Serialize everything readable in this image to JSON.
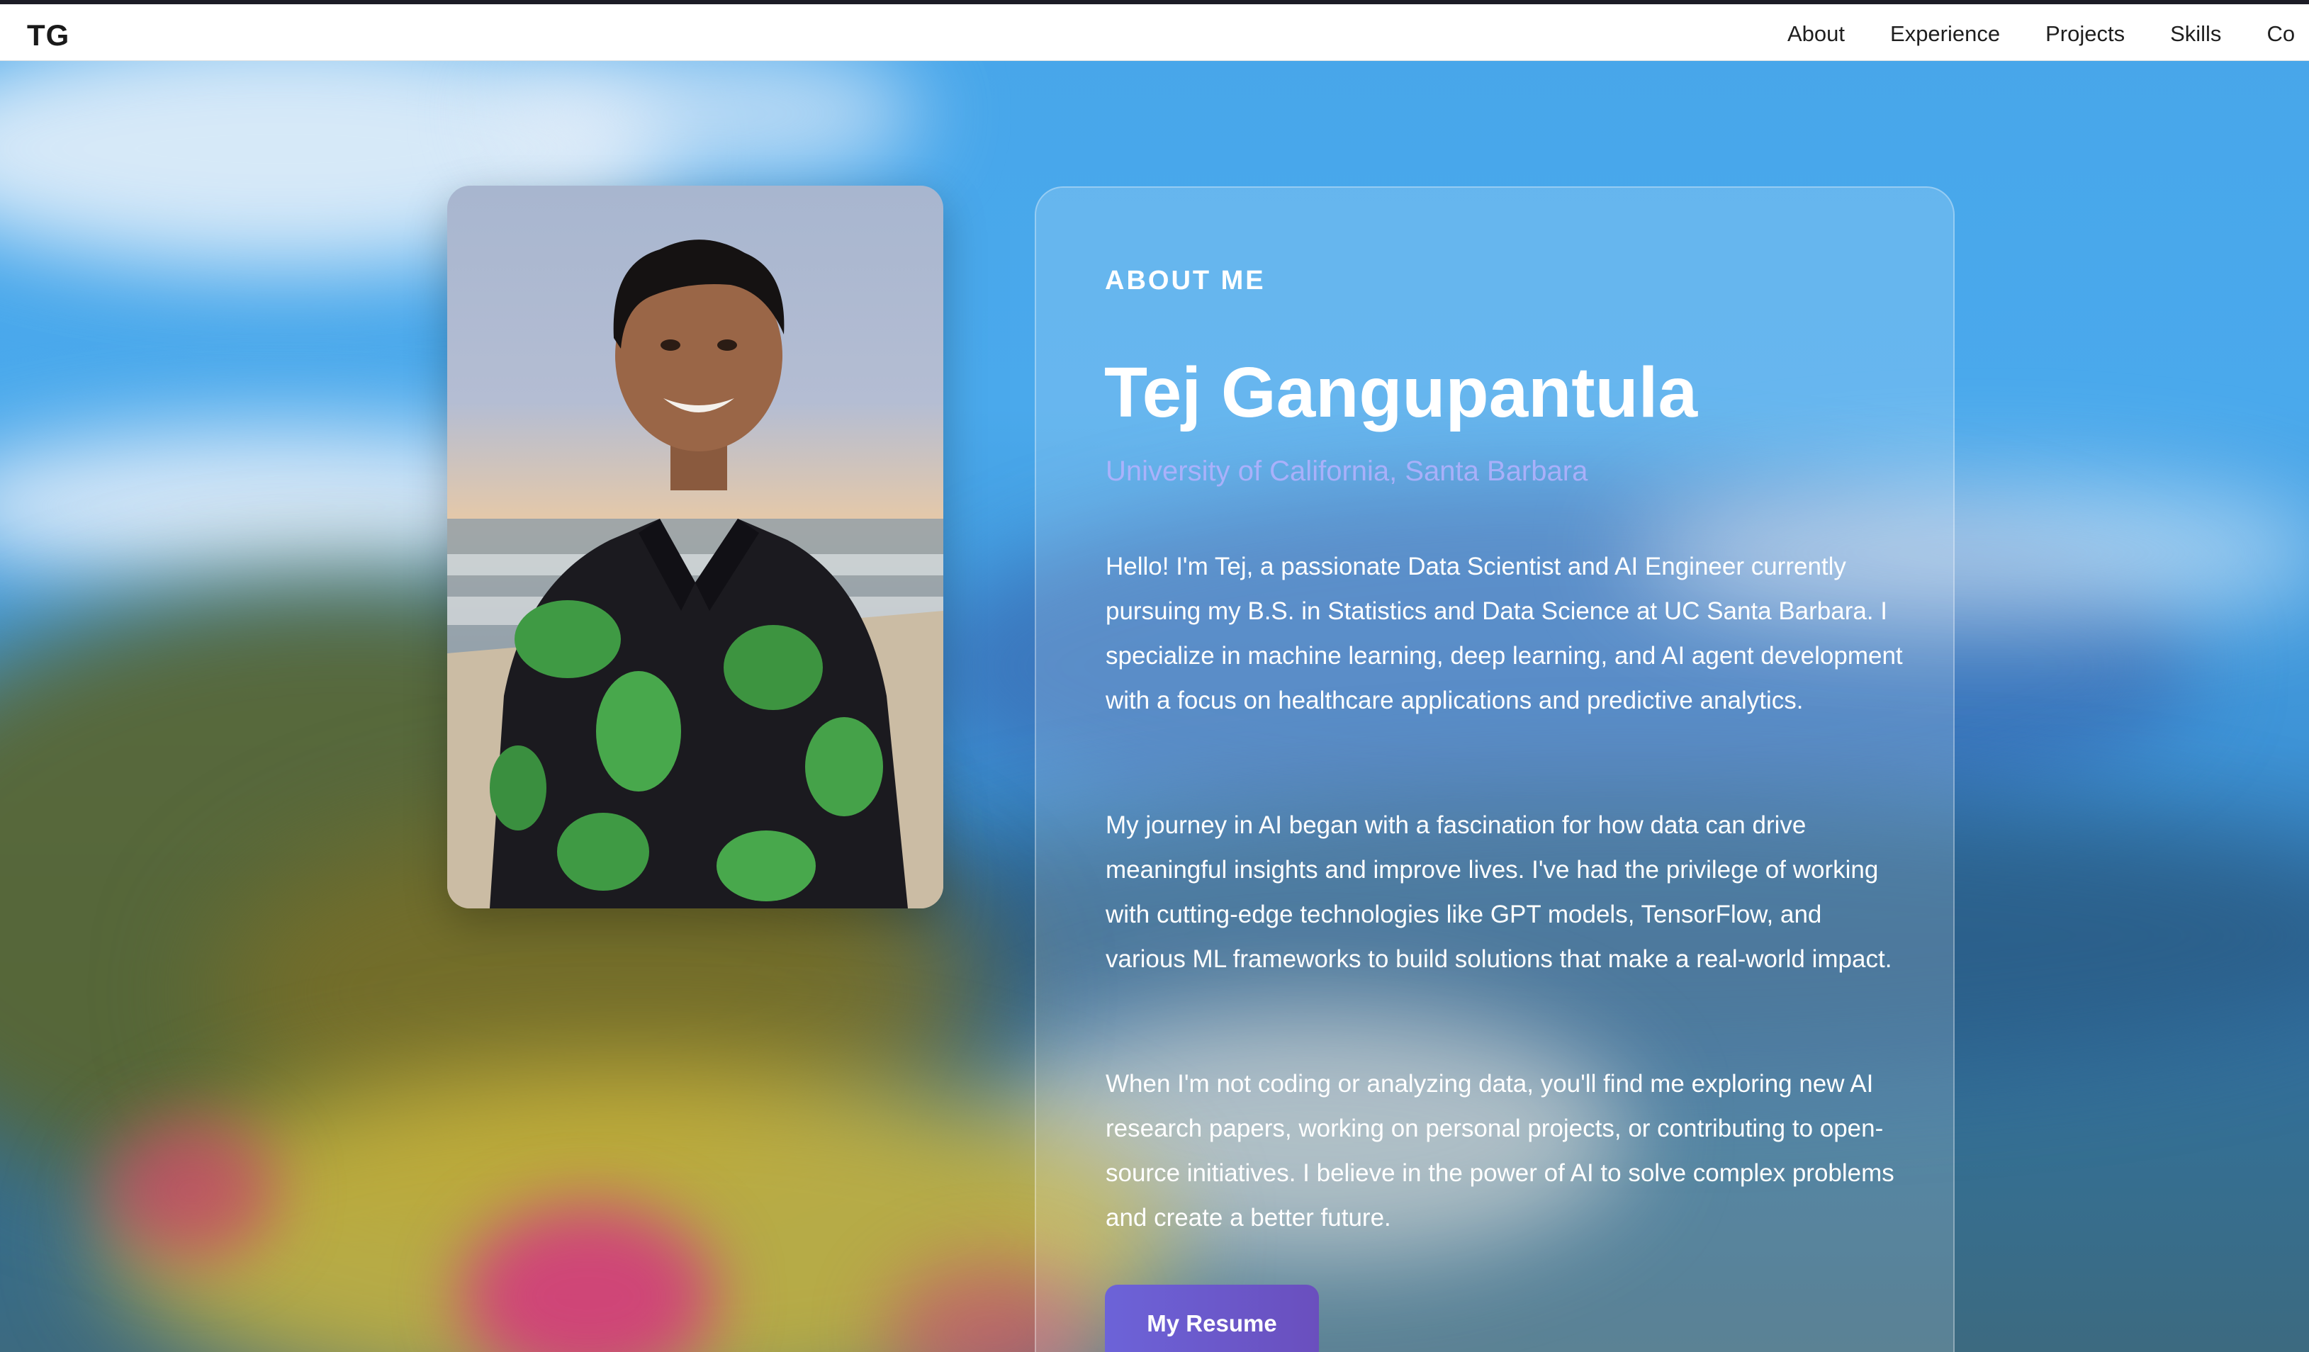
{
  "nav": {
    "logo": "TG",
    "items": [
      {
        "label": "About"
      },
      {
        "label": "Experience"
      },
      {
        "label": "Projects"
      },
      {
        "label": "Skills"
      },
      {
        "label": "Co"
      }
    ]
  },
  "about": {
    "eyebrow": "ABOUT ME",
    "name": "Tej Gangupantula",
    "school": "University of California, Santa Barbara",
    "paragraphs": [
      "Hello! I'm Tej, a passionate Data Scientist and AI Engineer currently pursuing my B.S. in Statistics and Data Science at UC Santa Barbara. I specialize in machine learning, deep learning, and AI agent development with a focus on healthcare applications and predictive analytics.",
      "My journey in AI began with a fascination for how data can drive meaningful insights and improve lives. I've had the privilege of working with cutting-edge technologies like GPT models, TensorFlow, and various ML frameworks to build solutions that make a real-world impact.",
      "When I'm not coding or analyzing data, you'll find me exploring new AI research papers, working on personal projects, or contributing to open-source initiatives. I believe in the power of AI to solve complex problems and create a better future."
    ],
    "resume_label": "My Resume"
  },
  "colors": {
    "accent": "#6a5acd",
    "nav_bg": "#ffffff",
    "nav_text": "#1f1f1f"
  }
}
